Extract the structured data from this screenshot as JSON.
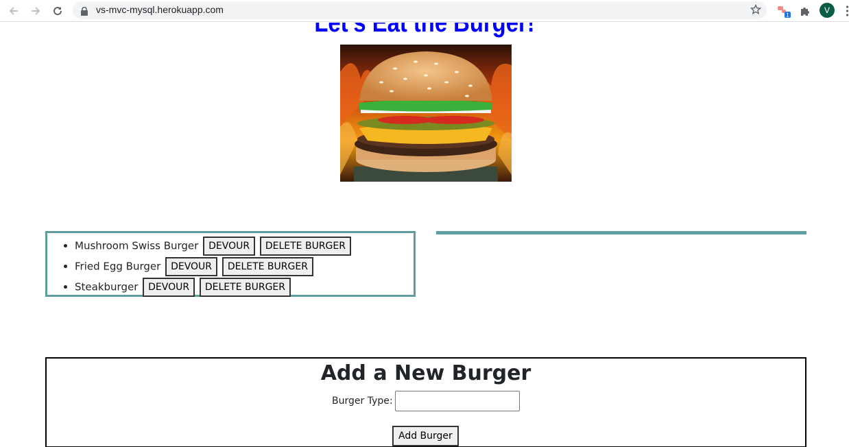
{
  "browser": {
    "url": "vs-mvc-mysql.herokuapp.com",
    "avatar_letter": "V",
    "extension_badge": "1"
  },
  "page": {
    "title": "Let's Eat the Burger!",
    "burgers": [
      {
        "name": "Mushroom Swiss Burger",
        "devour_label": "DEVOUR",
        "delete_label": "DELETE BURGER"
      },
      {
        "name": "Fried Egg Burger",
        "devour_label": "DEVOUR",
        "delete_label": "DELETE BURGER"
      },
      {
        "name": "Steakburger",
        "devour_label": "DEVOUR",
        "delete_label": "DELETE BURGER"
      }
    ],
    "form": {
      "heading": "Add a New Burger",
      "label": "Burger Type:",
      "input_value": "",
      "submit_label": "Add Burger"
    }
  },
  "colors": {
    "title": "#0000ff",
    "accent_border": "#5f9ea0"
  }
}
